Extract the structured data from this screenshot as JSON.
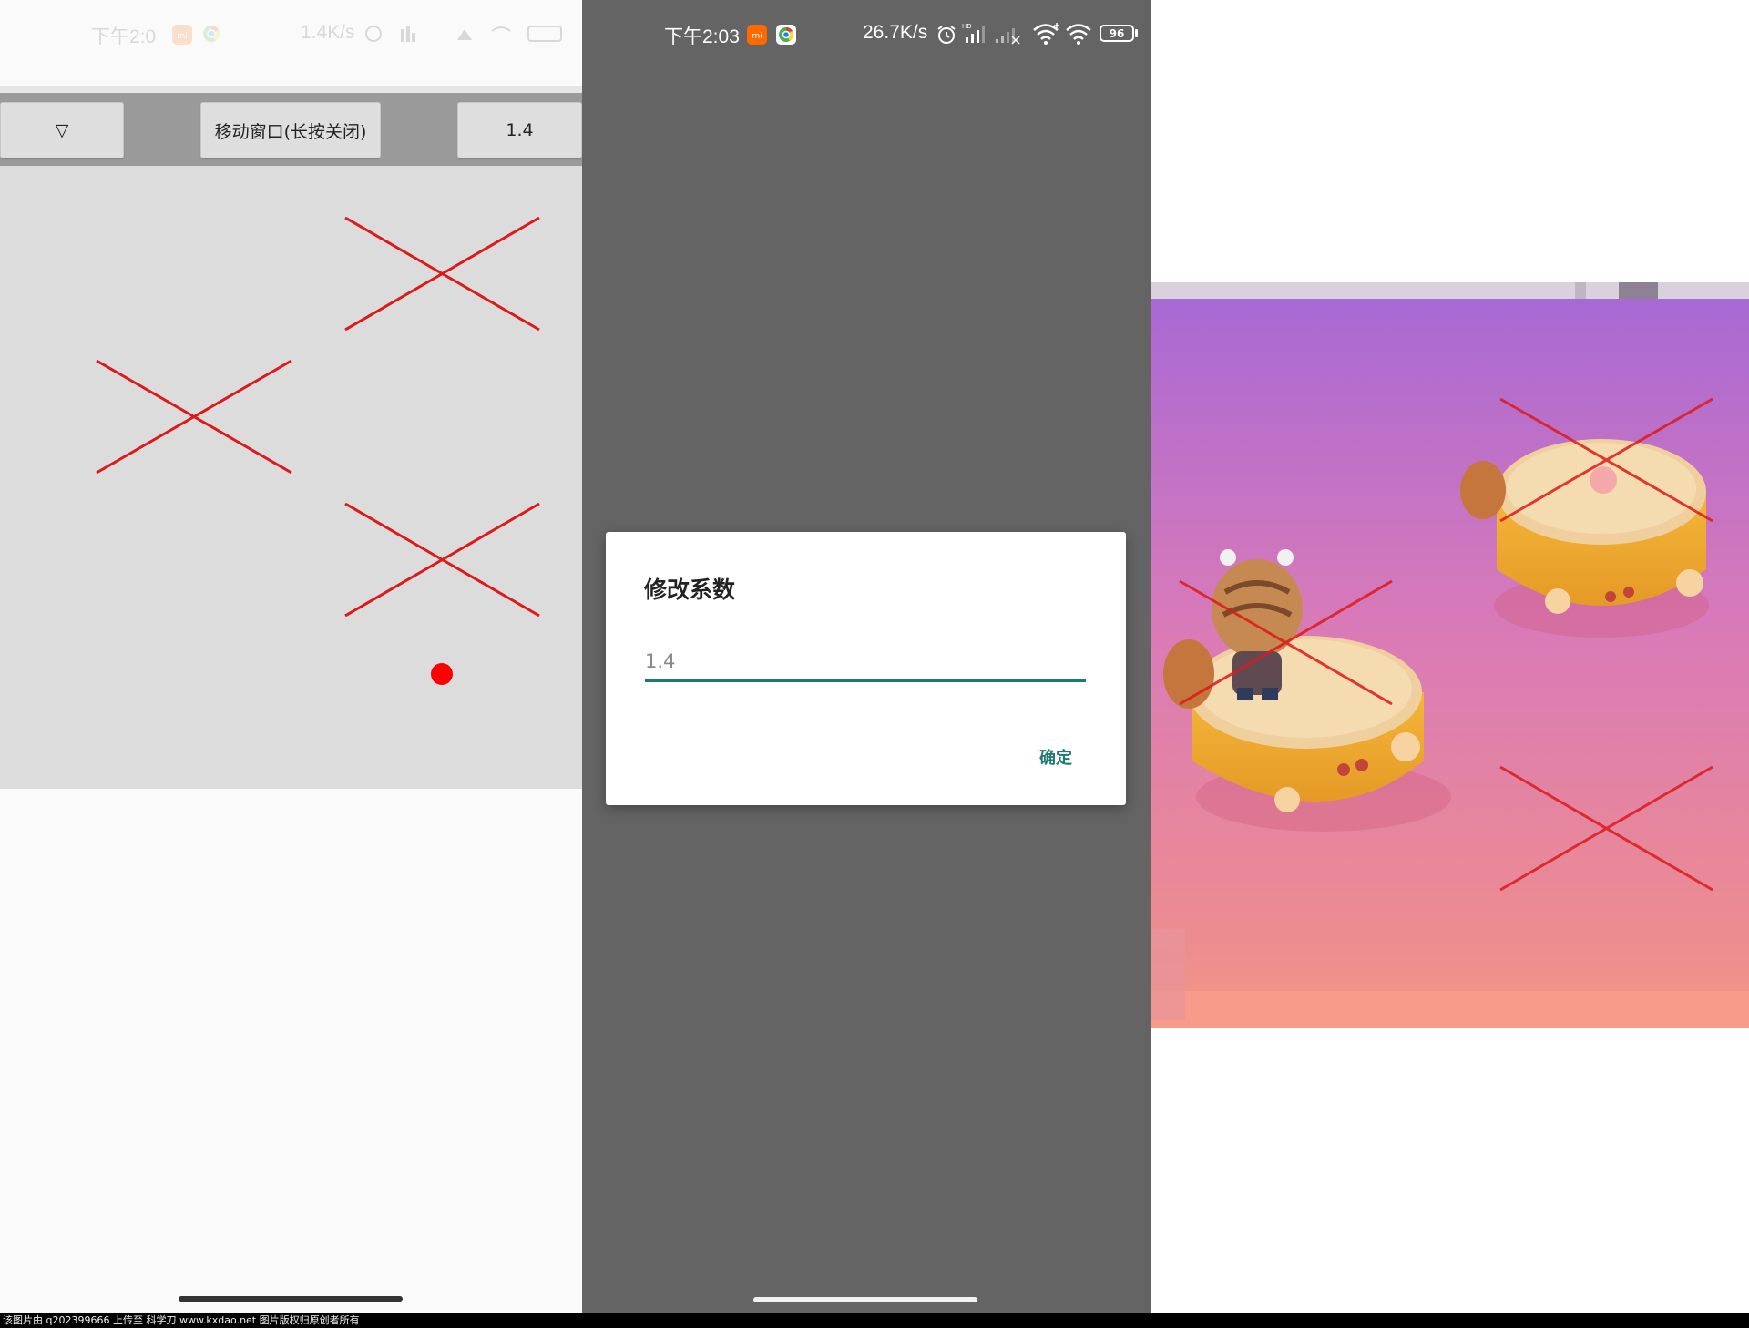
{
  "panel1": {
    "status_bar": {
      "time": "下午2:0",
      "speed": "1.4K/s"
    },
    "toolbar": {
      "dropdown_label": "▽",
      "move_window_label": "移动窗口(长按关闭)",
      "factor_label": "1.4"
    }
  },
  "panel2": {
    "status_bar": {
      "time": "下午2:03",
      "speed": "26.7K/s",
      "battery": "96"
    },
    "dialog": {
      "title": "修改系数",
      "input_value": "1.4",
      "confirm_label": "确定"
    }
  },
  "watermark": "该图片由 q202399666 上传至 科学刀 www.kxdao.net 图片版权归原创者所有",
  "colors": {
    "accent_teal": "#1f7a71",
    "marker_red": "#dd1a1a",
    "dot_red": "#ff0000",
    "dialog_backdrop": "#646464",
    "toolbar_gray": "#9a9a9a",
    "canvas_gray": "#dcdcdc"
  },
  "icons": [
    "mi-app-icon",
    "chrome-icon",
    "alarm-icon",
    "signal-hd-icon",
    "signal-weak-icon",
    "wifi-plus-icon",
    "wifi-icon",
    "battery-icon",
    "cross-marker-icon",
    "red-dot-icon"
  ]
}
